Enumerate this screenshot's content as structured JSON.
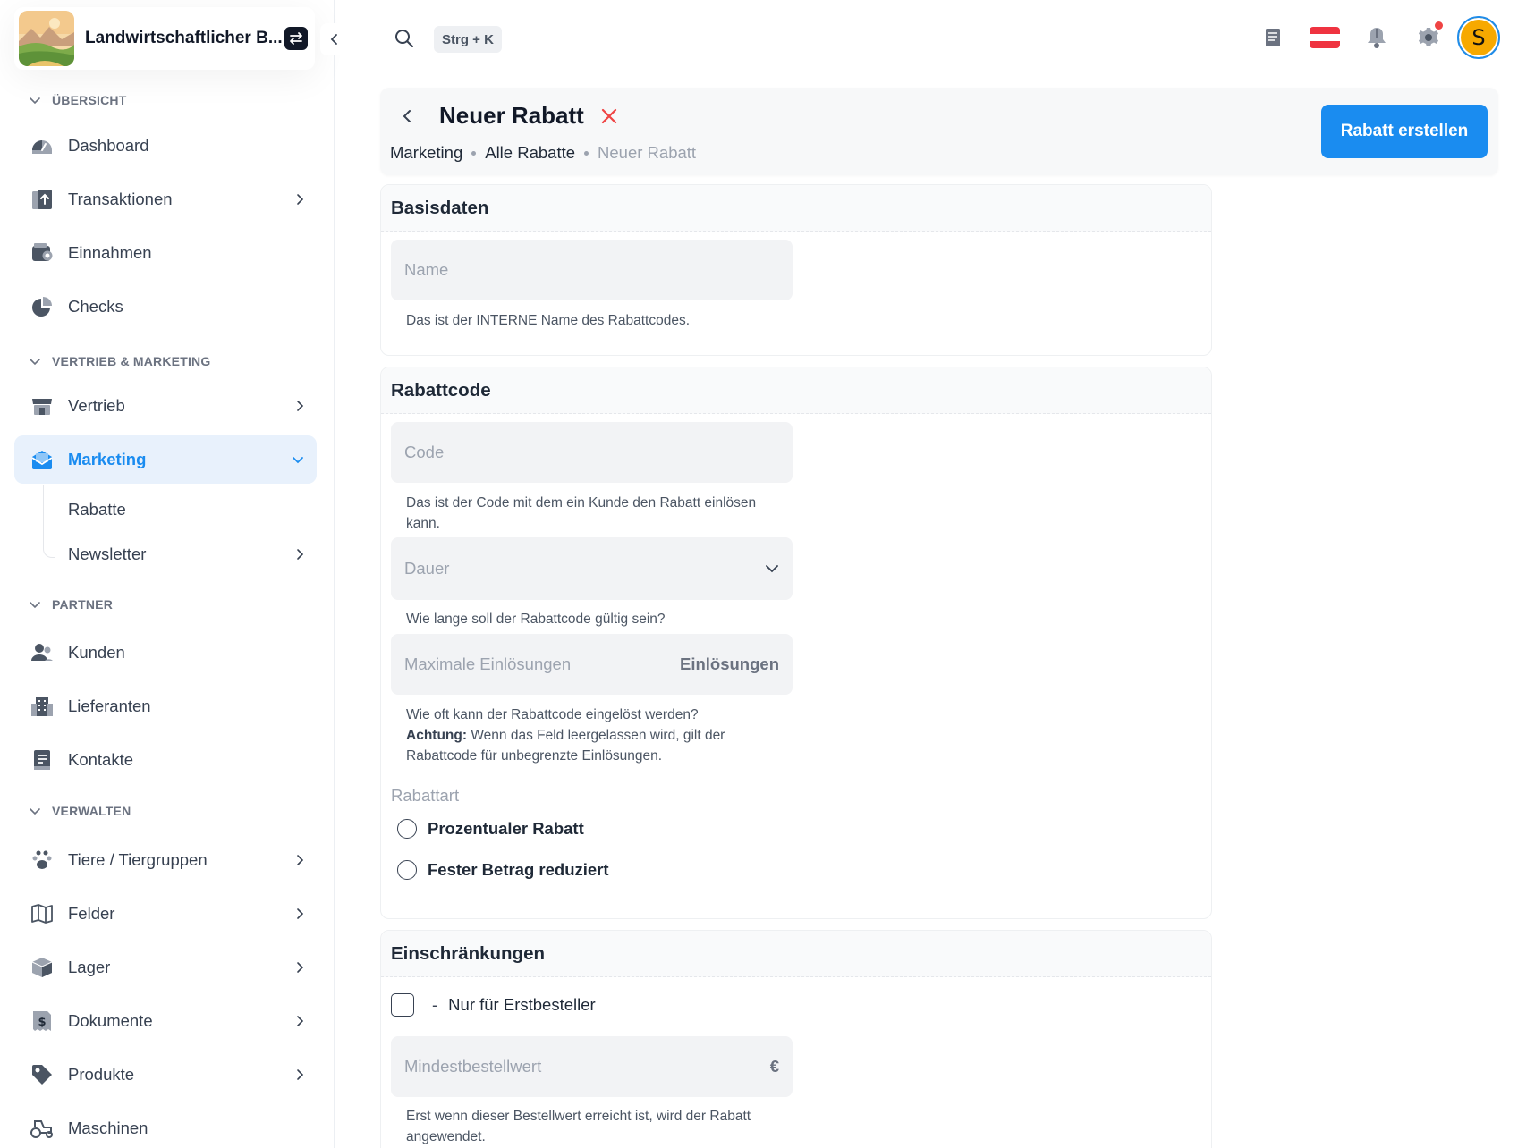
{
  "org": {
    "name": "Landwirtschaftlicher B..."
  },
  "sidebar": {
    "sections": [
      {
        "label": "ÜBERSICHT"
      },
      {
        "label": "VERTRIEB & MARKETING"
      },
      {
        "label": "PARTNER"
      },
      {
        "label": "VERWALTEN"
      }
    ],
    "items": [
      {
        "label": "Dashboard",
        "icon": "gauge-icon"
      },
      {
        "label": "Transaktionen",
        "icon": "transactions-icon"
      },
      {
        "label": "Einnahmen",
        "icon": "wallet-icon"
      },
      {
        "label": "Checks",
        "icon": "pie-chart-icon"
      },
      {
        "label": "Vertrieb",
        "icon": "store-icon"
      },
      {
        "label": "Marketing",
        "icon": "mail-marketing-icon"
      },
      {
        "label": "Kunden",
        "icon": "users-icon"
      },
      {
        "label": "Lieferanten",
        "icon": "building-icon"
      },
      {
        "label": "Kontakte",
        "icon": "contacts-book-icon"
      },
      {
        "label": "Tiere / Tiergruppen",
        "icon": "paw-icon"
      },
      {
        "label": "Felder",
        "icon": "map-icon"
      },
      {
        "label": "Lager",
        "icon": "box-icon"
      },
      {
        "label": "Dokumente",
        "icon": "invoice-icon"
      },
      {
        "label": "Produkte",
        "icon": "tag-icon"
      },
      {
        "label": "Maschinen",
        "icon": "tractor-icon"
      }
    ],
    "subitems": [
      {
        "label": "Rabatte"
      },
      {
        "label": "Newsletter"
      }
    ]
  },
  "topbar": {
    "shortcut": "Strg + K",
    "avatar_initial": "S",
    "accent": "#1a8cf0"
  },
  "page": {
    "title": "Neuer Rabatt",
    "breadcrumb": [
      "Marketing",
      "Alle Rabatte",
      "Neuer Rabatt"
    ],
    "primary_button": "Rabatt erstellen"
  },
  "basisdaten": {
    "title": "Basisdaten",
    "name_placeholder": "Name",
    "name_help": "Das ist der INTERNE Name des Rabattcodes."
  },
  "rabattcode": {
    "title": "Rabattcode",
    "code_placeholder": "Code",
    "code_help": "Das ist der Code mit dem ein Kunde den Rabatt einlösen kann.",
    "dauer_placeholder": "Dauer",
    "dauer_help": "Wie lange soll der Rabattcode gültig sein?",
    "max_placeholder": "Maximale Einlösungen",
    "max_suffix": "Einlösungen",
    "max_help_line1": "Wie oft kann der Rabattcode eingelöst werden?",
    "max_help_bold": "Achtung:",
    "max_help_line2": " Wenn das Feld leergelassen wird, gilt der Rabattcode für unbegrenzte Einlösungen.",
    "art_label": "Rabattart",
    "art_options": [
      "Prozentualer Rabatt",
      "Fester Betrag reduziert"
    ]
  },
  "einschraenkungen": {
    "title": "Einschränkungen",
    "dash": "-",
    "erstbesteller_label": "Nur für Erstbesteller",
    "mbw_placeholder": "Mindestbestellwert",
    "mbw_suffix": "€",
    "mbw_help": "Erst wenn dieser Bestellwert erreicht ist, wird der Rabatt angewendet."
  }
}
